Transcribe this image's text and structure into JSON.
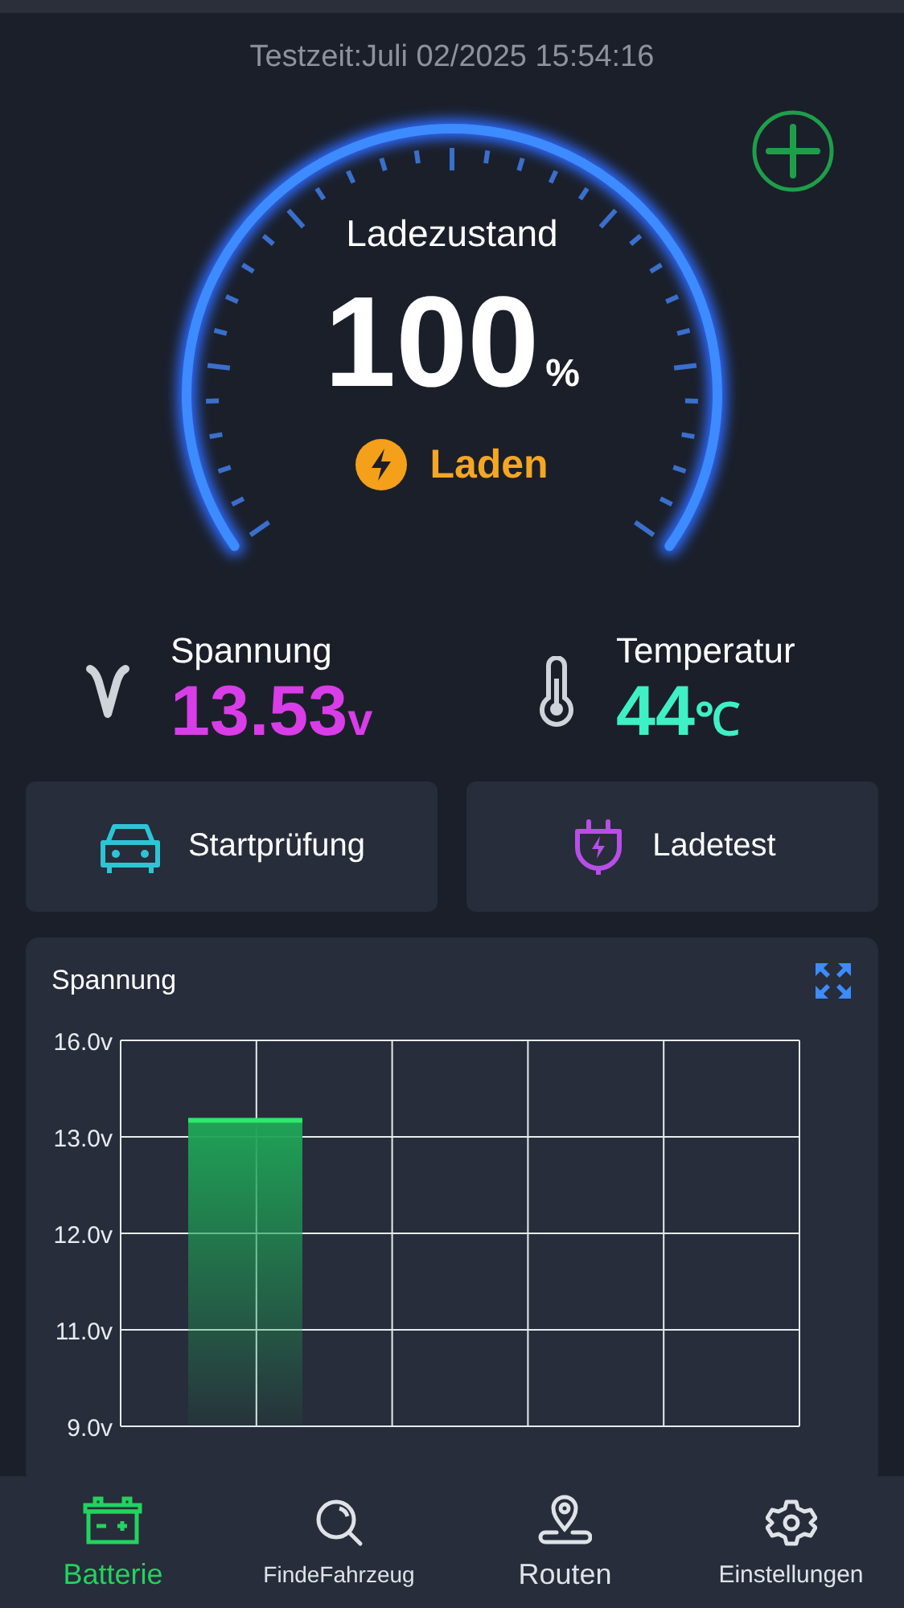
{
  "header": {
    "test_time": "Testzeit:Juli 02/2025 15:54:16"
  },
  "gauge": {
    "label": "Ladezustand",
    "value": "100",
    "unit": "%",
    "status": "Laden"
  },
  "stats": [
    {
      "kind": "voltage",
      "label": "Spannung",
      "value": "13.53",
      "unit": "v",
      "color": "#d93de8"
    },
    {
      "kind": "temperature",
      "label": "Temperatur",
      "value": "44",
      "unit": "℃",
      "color": "#3ff0c4"
    }
  ],
  "actions": [
    {
      "kind": "car",
      "label": "Startprüfung"
    },
    {
      "kind": "plug",
      "label": "Ladetest"
    }
  ],
  "chart": {
    "title": "Spannung",
    "y_labels": [
      "16.0v",
      "13.0v",
      "12.0v",
      "11.0v",
      "9.0v"
    ]
  },
  "nav": [
    {
      "kind": "battery",
      "label": "Batterie",
      "selected": true
    },
    {
      "kind": "search",
      "label": "FindeFahrzeug",
      "selected": false
    },
    {
      "kind": "route",
      "label": "Routen",
      "selected": false
    },
    {
      "kind": "settings",
      "label": "Einstellungen",
      "selected": false
    }
  ]
}
